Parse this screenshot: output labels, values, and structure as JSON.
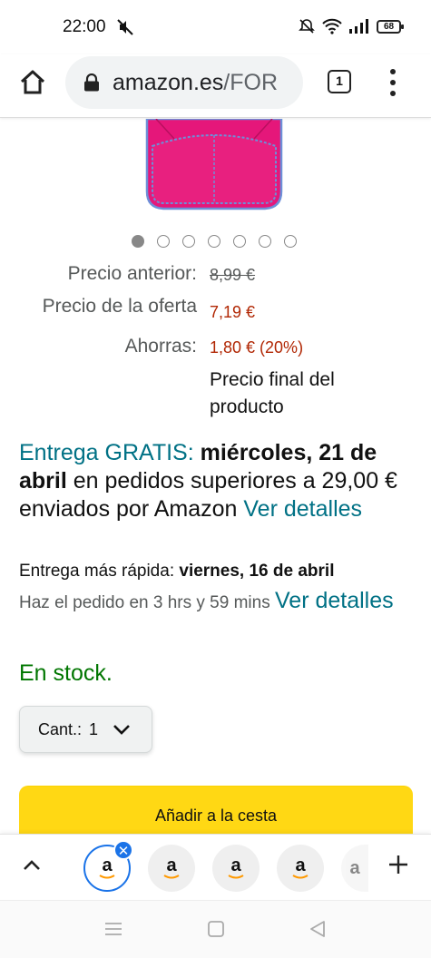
{
  "status_bar": {
    "time": "22:00",
    "battery": "68",
    "icons": [
      "mute-icon",
      "alarm-off-icon",
      "wifi-icon",
      "signal-icon",
      "battery-icon"
    ]
  },
  "browser": {
    "url_domain": "amazon.es",
    "url_path": "/FOR",
    "tab_count": "1",
    "icons": [
      "home-icon",
      "lock-icon",
      "tabs-icon",
      "more-vert-icon"
    ]
  },
  "carousel": {
    "dot_count": 7,
    "active_index": 0
  },
  "pricing": {
    "previous_label": "Precio anterior:",
    "previous_value": "8,99 €",
    "deal_label": "Precio de la oferta",
    "deal_value": "7,19 €",
    "savings_label": "Ahorras:",
    "savings_value": "1,80 € (20%)",
    "final_note": "Precio final del producto"
  },
  "delivery": {
    "free_label": "Entrega GRATIS:",
    "date": "miércoles, 21 de abril",
    "condition": "en pedidos superiores a 29,00 € enviados por Amazon",
    "details_link": "Ver detalles",
    "fast_label": "Entrega más rápida:",
    "fast_date": "viernes, 16 de abril",
    "order_within": "Haz el pedido en 3 hrs y 59 mins",
    "fast_details_link": "Ver detalles"
  },
  "stock": {
    "status": "En stock."
  },
  "quantity": {
    "label": "Cant.:",
    "value": "1"
  },
  "cart": {
    "add_label": "Añadir a la cesta"
  },
  "tab_strip": {
    "tabs": [
      {
        "logo": "a",
        "active": true
      },
      {
        "logo": "a",
        "active": false
      },
      {
        "logo": "a",
        "active": false
      },
      {
        "logo": "a",
        "active": false
      },
      {
        "logo": "a",
        "active": false
      }
    ],
    "icons": [
      "chevron-up-icon",
      "close-icon",
      "plus-icon"
    ]
  },
  "nav_bar": {
    "icons": [
      "recents-icon",
      "home-nav-icon",
      "back-icon"
    ]
  },
  "colors": {
    "accent_teal": "#007185",
    "deal_red": "#b12704",
    "stock_green": "#007600",
    "cart_yellow": "#ffd814",
    "product_pink": "#e5177a"
  }
}
